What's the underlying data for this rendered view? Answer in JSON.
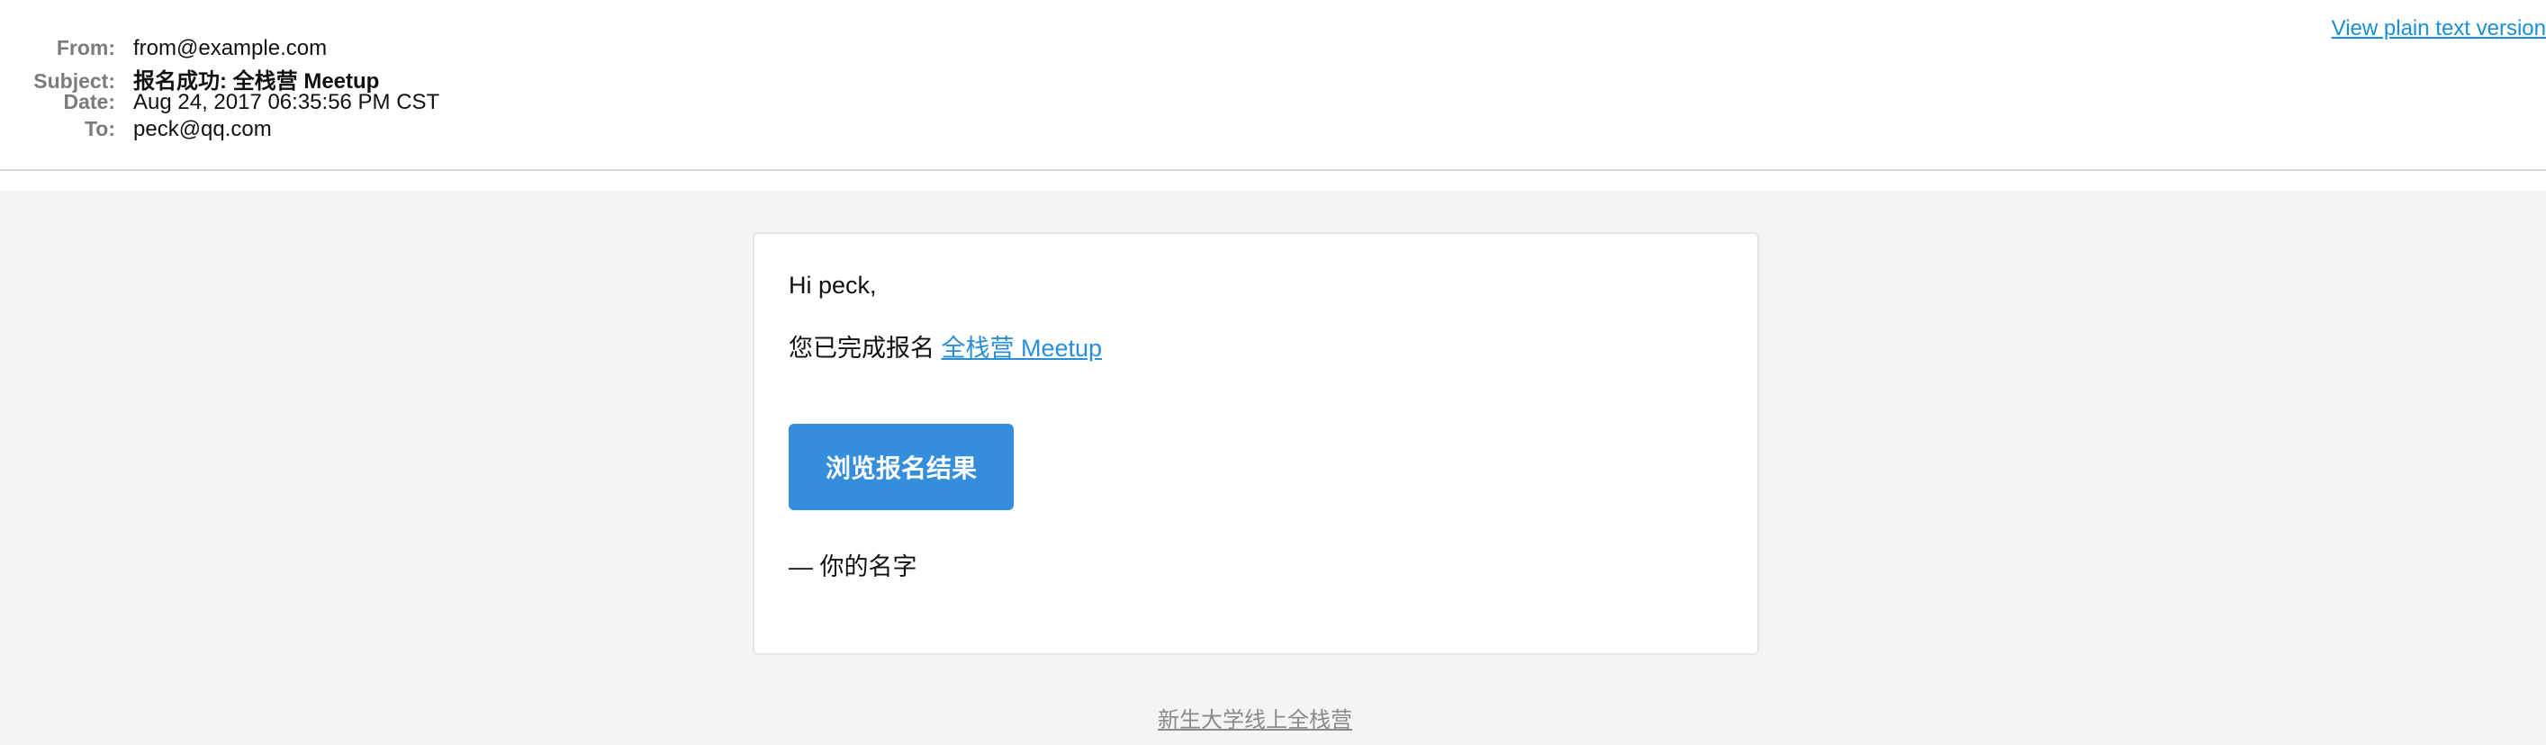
{
  "header": {
    "plain_text_link": "View plain text version",
    "fields": [
      {
        "label": "From:",
        "value": "from@example.com"
      },
      {
        "label": "Subject:",
        "value": "报名成功: 全栈营 Meetup"
      },
      {
        "label": "Date:",
        "value": "Aug 24, 2017 06:35:56 PM CST"
      },
      {
        "label": "To:",
        "value": "peck@qq.com"
      }
    ]
  },
  "email": {
    "greeting": "Hi peck,",
    "signup_text": "您已完成报名",
    "event_link": "全栈营 Meetup",
    "button_label": "浏览报名结果",
    "signature": "— 你的名字"
  },
  "footer": {
    "link": "新生大学线上全栈营"
  },
  "colors": {
    "link": "#1a8fd6",
    "button": "#348edb",
    "background": "#f4f4f4"
  }
}
